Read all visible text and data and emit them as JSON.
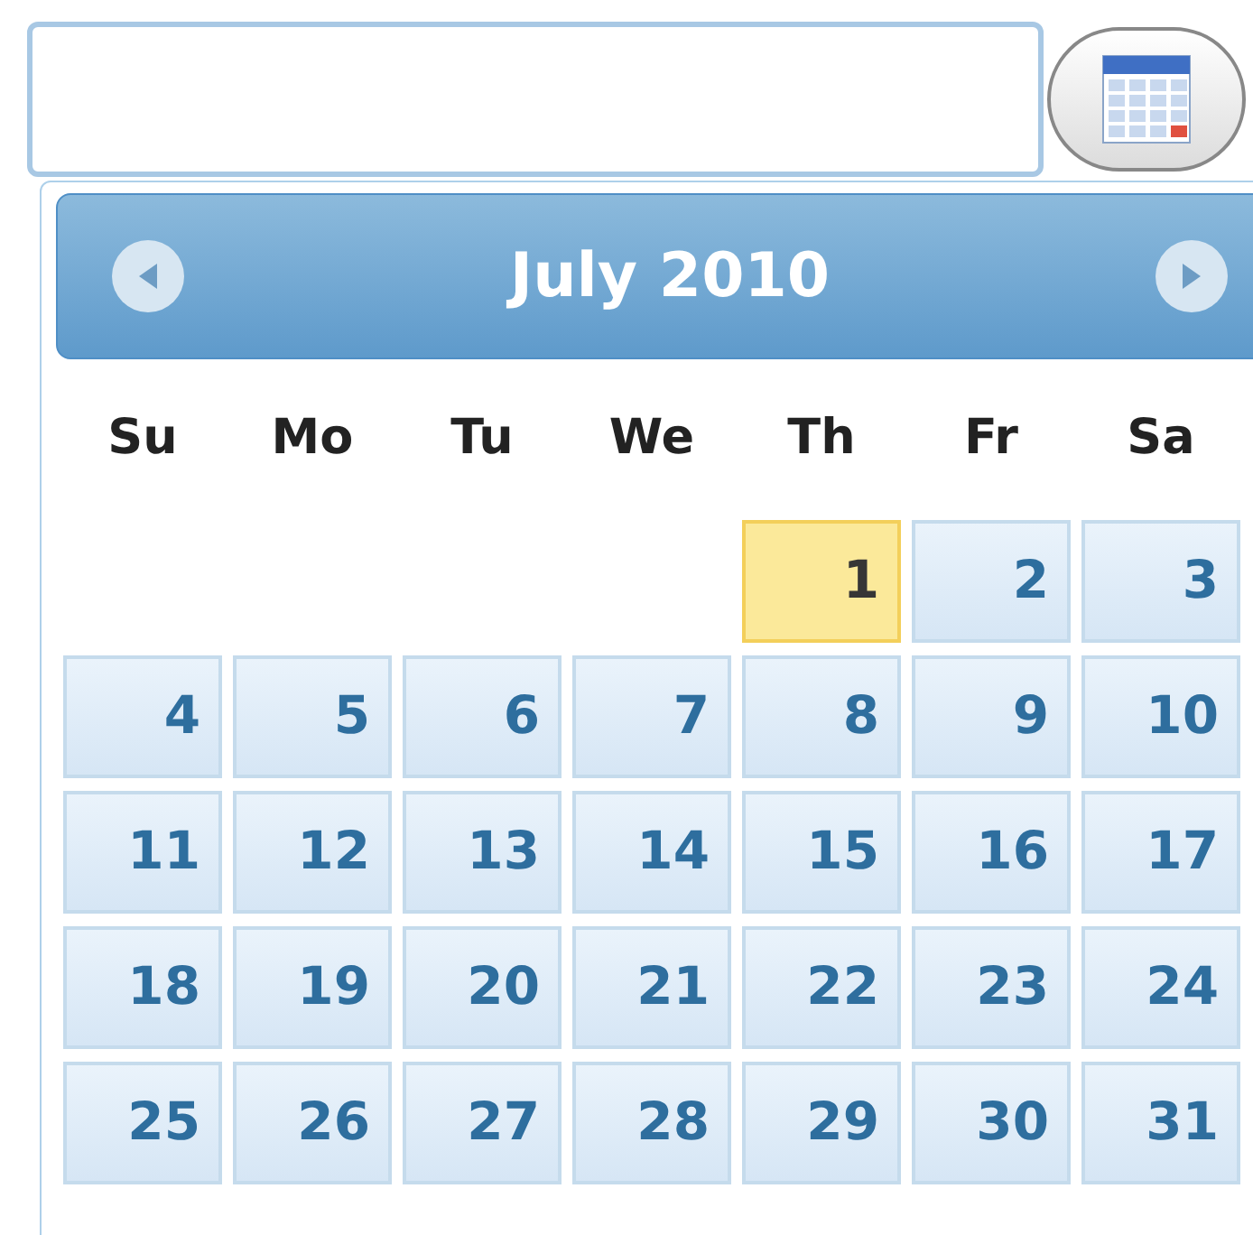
{
  "calendar": {
    "title": "July 2010",
    "weekdays": [
      "Su",
      "Mo",
      "Tu",
      "We",
      "Th",
      "Fr",
      "Sa"
    ],
    "weeks": [
      [
        {
          "day": "1",
          "today": true
        },
        {
          "day": "2",
          "today": false
        },
        {
          "day": "3",
          "today": false
        }
      ],
      [
        {
          "day": "4",
          "today": false
        },
        {
          "day": "5",
          "today": false
        },
        {
          "day": "6",
          "today": false
        },
        {
          "day": "7",
          "today": false
        },
        {
          "day": "8",
          "today": false
        },
        {
          "day": "9",
          "today": false
        },
        {
          "day": "10",
          "today": false
        }
      ],
      [
        {
          "day": "11",
          "today": false
        },
        {
          "day": "12",
          "today": false
        },
        {
          "day": "13",
          "today": false
        },
        {
          "day": "14",
          "today": false
        },
        {
          "day": "15",
          "today": false
        },
        {
          "day": "16",
          "today": false
        },
        {
          "day": "17",
          "today": false
        }
      ],
      [
        {
          "day": "18",
          "today": false
        },
        {
          "day": "19",
          "today": false
        },
        {
          "day": "20",
          "today": false
        },
        {
          "day": "21",
          "today": false
        },
        {
          "day": "22",
          "today": false
        },
        {
          "day": "23",
          "today": false
        },
        {
          "day": "24",
          "today": false
        }
      ],
      [
        {
          "day": "25",
          "today": false
        },
        {
          "day": "26",
          "today": false
        },
        {
          "day": "27",
          "today": false
        },
        {
          "day": "28",
          "today": false
        },
        {
          "day": "29",
          "today": false
        },
        {
          "day": "30",
          "today": false
        },
        {
          "day": "31",
          "today": false
        }
      ]
    ]
  }
}
